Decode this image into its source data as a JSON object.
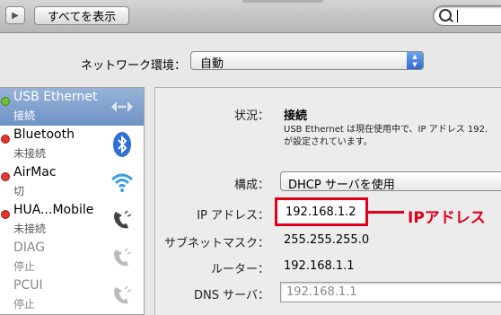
{
  "toolbar": {
    "forward_icon": "play-forward-icon",
    "show_all_label": "すべてを表示",
    "search_icon": "search-icon"
  },
  "location": {
    "label": "ネットワーク環境：",
    "value": "自動"
  },
  "services": [
    {
      "name": "USB Ethernet",
      "status": "接続",
      "dot_color": "#6fbe3a",
      "icon": "ethernet-arrows-icon",
      "selected": true
    },
    {
      "name": "Bluetooth",
      "status": "未接続",
      "dot_color": "#e2362e",
      "icon": "bluetooth-icon"
    },
    {
      "name": "AirMac",
      "status": "切",
      "dot_color": "#e2362e",
      "icon": "wifi-icon"
    },
    {
      "name": "HUA...Mobile",
      "status": "未接続",
      "dot_color": "#e2362e",
      "icon": "phone-icon"
    },
    {
      "name": "DIAG",
      "status": "停止",
      "dot_color": "",
      "icon": "phone-icon"
    },
    {
      "name": "PCUI",
      "status": "停止",
      "dot_color": "",
      "icon": "phone-icon"
    }
  ],
  "details": {
    "status_label": "状況：",
    "status_value": "接続",
    "status_desc_line1": "USB Ethernet は現在使用中で、IP アドレス 192.",
    "status_desc_line2": "が設定されています。",
    "config_label": "構成：",
    "config_value": "DHCP サーバを使用",
    "ip_label": "IP アドレス：",
    "ip_value": "192.168.1.2",
    "subnet_label": "サブネットマスク：",
    "subnet_value": "255.255.255.0",
    "router_label": "ルーター：",
    "router_value": "192.168.1.1",
    "dns_label": "DNS サーバ：",
    "dns_placeholder": "192.168.1.1"
  },
  "annotation": {
    "text": "IPアドレス",
    "color": "#e0001b"
  }
}
